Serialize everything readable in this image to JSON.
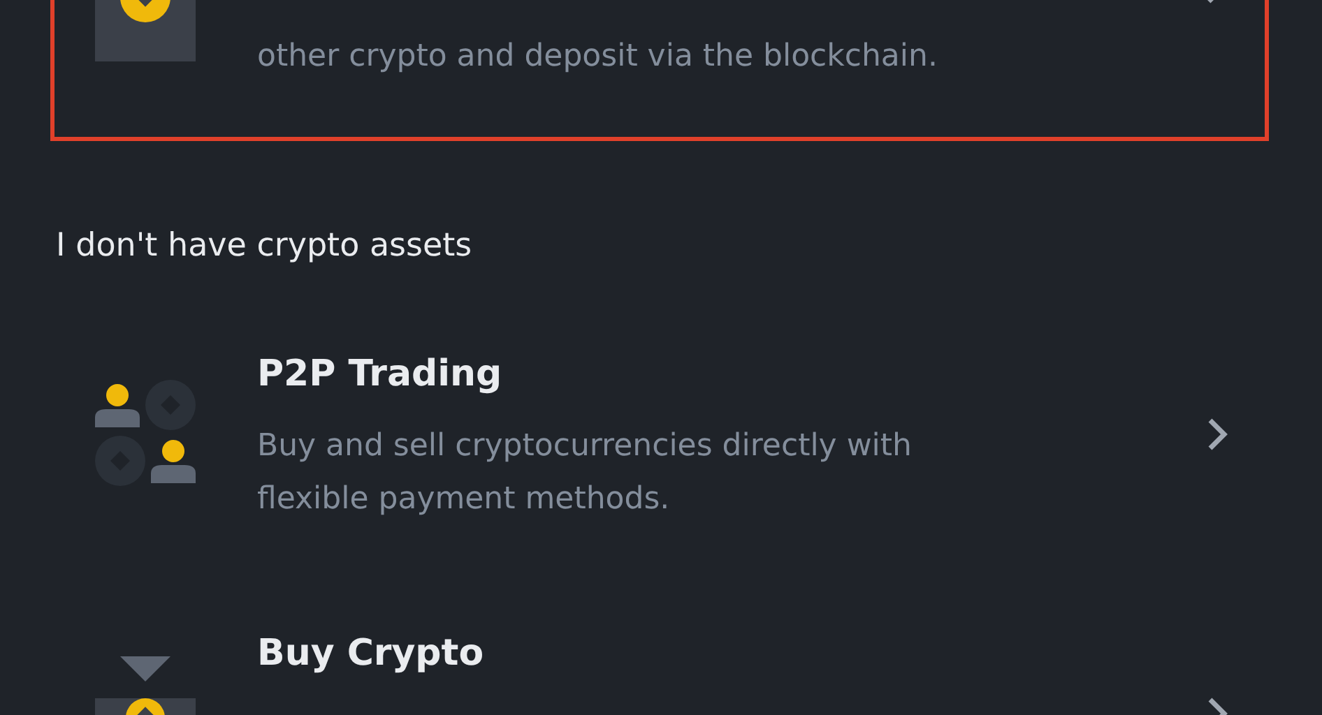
{
  "deposit_card": {
    "description": "other crypto and deposit via the blockchain.",
    "highlighted": true
  },
  "section_title": "I don't have crypto assets",
  "options": [
    {
      "kind": "p2p",
      "title": "P2P Trading",
      "description": "Buy and sell cryptocurrencies directly with flexible payment methods."
    },
    {
      "kind": "buy",
      "title": "Buy Crypto"
    }
  ]
}
